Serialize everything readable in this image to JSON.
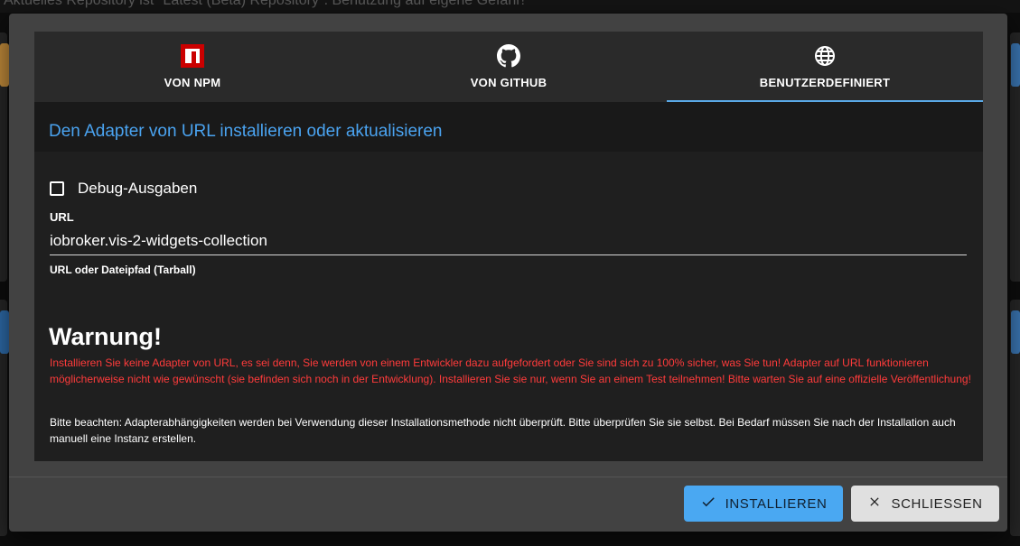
{
  "background": {
    "top_bar_text": "Aktuelles Repository ist \"Latest (Beta) Repository\". Benutzung auf eigene Gefahr!"
  },
  "dialog": {
    "tabs": [
      {
        "label": "VON NPM",
        "icon": "npm-icon",
        "active": false
      },
      {
        "label": "VON GITHUB",
        "icon": "github-icon",
        "active": false
      },
      {
        "label": "BENUTZERDEFINIERT",
        "icon": "globe-icon",
        "active": true
      }
    ],
    "header_title": "Den Adapter von URL installieren oder aktualisieren",
    "debug_checkbox": {
      "label": "Debug-Ausgaben",
      "checked": false
    },
    "url_field": {
      "label": "URL",
      "value": "iobroker.vis-2-widgets-collection",
      "helper": "URL oder Dateipfad (Tarball)"
    },
    "warning": {
      "title": "Warnung!",
      "text": "Installieren Sie keine Adapter von URL, es sei denn, Sie werden von einem Entwickler dazu aufgefordert oder Sie sind sich zu 100% sicher, was Sie tun! Adapter auf URL funktionieren möglicherweise nicht wie gewünscht (sie befinden sich noch in der Entwicklung). Installieren Sie sie nur, wenn Sie an einem Test teilnehmen! Bitte warten Sie auf eine offizielle Veröffentlichung!",
      "color": "#ff3b3b"
    },
    "note": "Bitte beachten: Adapterabhängigkeiten werden bei Verwendung dieser Installationsmethode nicht überprüft. Bitte überprüfen Sie sie selbst. Bei Bedarf müssen Sie nach der Installation auch manuell eine Instanz erstellen.",
    "buttons": {
      "install_label": "INSTALLIEREN",
      "close_label": "SCHLIESSEN"
    },
    "colors": {
      "accent": "#4aa8f2",
      "header_title": "#4aa3f0",
      "npm_red": "#cb0000"
    }
  }
}
